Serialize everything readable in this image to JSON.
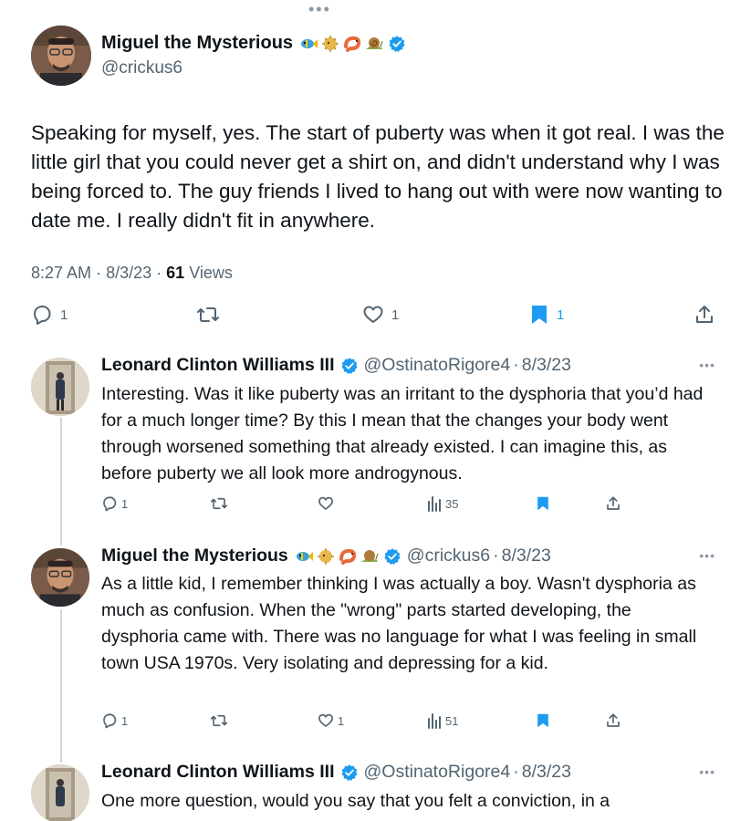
{
  "main_tweet": {
    "author_name": "Miguel the Mysterious",
    "handle": "@crickus6",
    "emojis": [
      "fish-emoji",
      "blowfish-emoji",
      "shrimp-emoji",
      "snail-emoji"
    ],
    "text": "Speaking for myself, yes. The start of puberty was when it got real. I was the little girl that you could never get a shirt on, and didn't understand why I was being forced to. The guy friends I lived to hang out with were now wanting to date me. I really didn't fit in anywhere.",
    "time": "8:27 AM",
    "date": "8/3/23",
    "views_count": "61",
    "views_label": "Views",
    "actions": {
      "replies": "1",
      "retweets": "",
      "likes": "1",
      "bookmarks": "1"
    }
  },
  "replies": [
    {
      "author_name": "Leonard Clinton Williams III",
      "handle": "@OstinatoRigore4",
      "date": "8/3/23",
      "text": "Interesting. Was it like puberty was an irritant to the dysphoria that you’d had for a much longer time? By this I mean that the changes your body went through worsened something that already existed. I can imagine this, as before puberty we all look more androgynous.",
      "actions": {
        "replies": "1",
        "retweets": "",
        "likes": "",
        "views": "35"
      }
    },
    {
      "author_name": "Miguel the Mysterious",
      "handle": "@crickus6",
      "date": "8/3/23",
      "text": "As a little kid, I remember thinking I was actually a boy. Wasn't dysphoria as much as confusion. When the \"wrong\" parts started developing, the dysphoria came with. There was no language for what I was feeling in small town USA 1970s. Very isolating and depressing for a kid.",
      "actions": {
        "replies": "1",
        "retweets": "",
        "likes": "1",
        "views": "51"
      }
    },
    {
      "author_name": "Leonard Clinton Williams III",
      "handle": "@OstinatoRigore4",
      "date": "8/3/23",
      "text": "One more question, would you say that you felt a conviction, in a"
    }
  ],
  "separator": "·",
  "colors": {
    "verified": "#1d9bf0",
    "bookmark_active": "#1d9bf0",
    "secondary_text": "#536471",
    "thread_line": "#cfd9de"
  }
}
